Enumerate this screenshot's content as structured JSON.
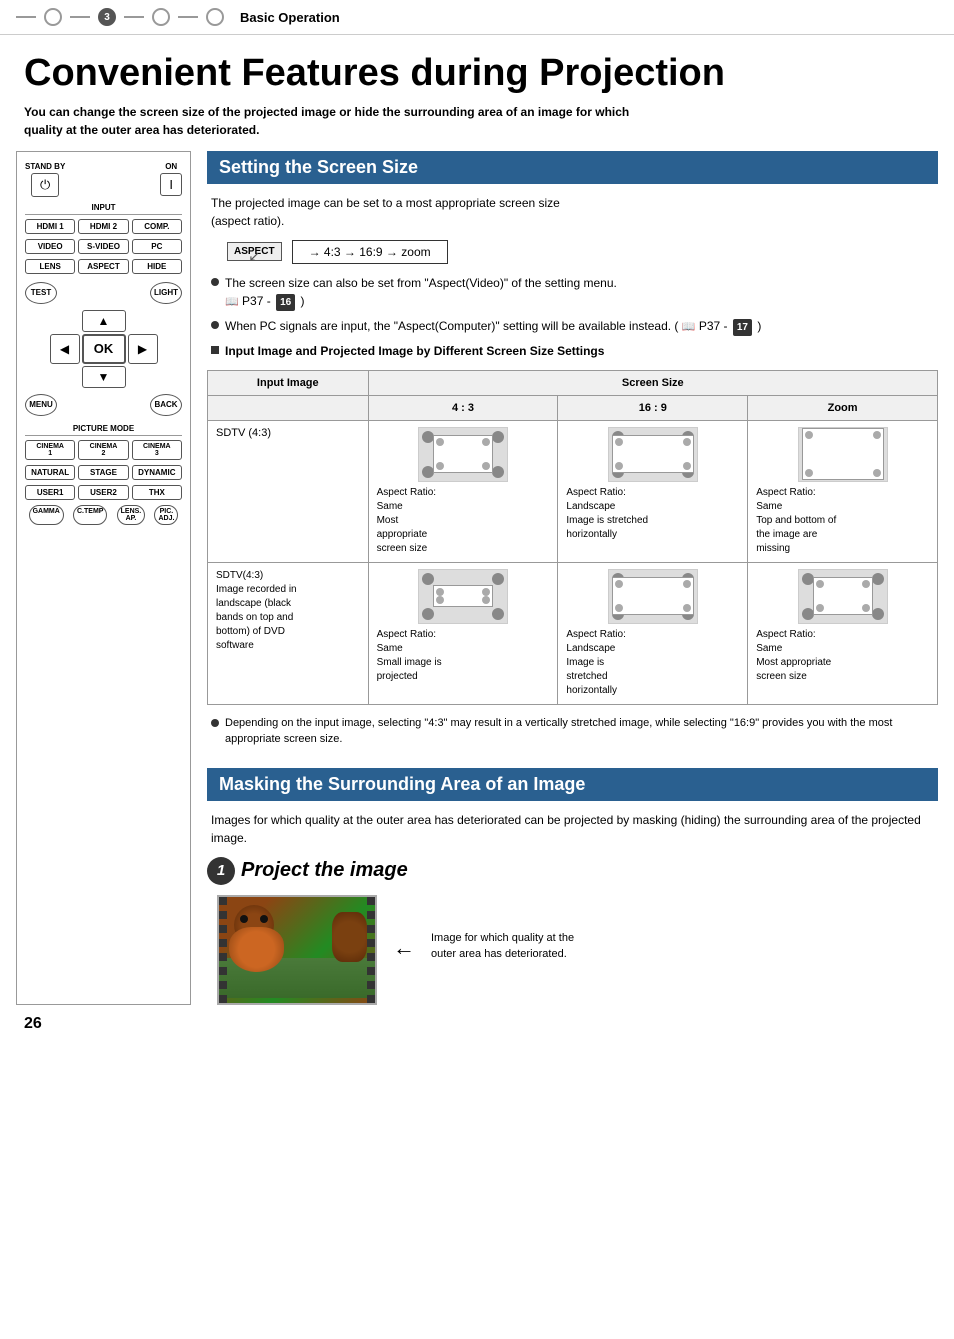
{
  "nav": {
    "step": "3",
    "title": "Basic Operation"
  },
  "page_title": "Convenient Features during Projection",
  "subtitle": "You can change the screen size of the projected image or hide the surrounding area of an image for which\nquality at the outer area has deteriorated.",
  "setting_screen_size": {
    "header": "Setting the Screen Size",
    "text": "The projected image can be set to a most appropriate screen size\n(aspect ratio).",
    "aspect_btn": "ASPECT",
    "aspect_sequence": "→ 4:3 → 16:9 → zoom",
    "bullet1": "The screen size can also be set from \"Aspect(Video)\" of the setting menu.",
    "bullet1_ref": "P37 -",
    "bullet1_badge": "16",
    "bullet2": "When PC signals are input, the \"Aspect(Computer)\" setting will be available instead.",
    "bullet2_ref": "P37 -",
    "bullet2_badge": "17",
    "table_header": "Input Image and Projected Image by Different Screen Size Settings",
    "table": {
      "screen_size_label": "Screen Size",
      "input_image_label": "Input Image",
      "cols": [
        "4 : 3",
        "16 : 9",
        "Zoom"
      ],
      "rows": [
        {
          "input_label": "SDTV (4:3)",
          "cells": [
            {
              "desc": "Aspect Ratio:\nSame\nMost\nappropriate\nscreen size",
              "img_type": "normal"
            },
            {
              "desc": "Aspect Ratio:\nLandscape\nImage is stretched\nhorizontally",
              "img_type": "wide"
            },
            {
              "desc": "Aspect Ratio:\nSame\nTop and bottom of\nthe image are\nmissing",
              "img_type": "crop_top_bottom"
            }
          ]
        },
        {
          "input_label": "SDTV(4:3)\nImage recorded in\nlandscape (black\nbands on top and\nbottom) of DVD\nsoftware",
          "cells": [
            {
              "desc": "Aspect Ratio:\nSame\nSmall image is\nprojected",
              "img_type": "small_in_normal"
            },
            {
              "desc": "Aspect Ratio:\nLandscape\nImage is\nstretched\nhorizontally",
              "img_type": "wide"
            },
            {
              "desc": "Aspect Ratio:\nSame\nMost appropriate\nscreen size",
              "img_type": "normal"
            }
          ]
        }
      ]
    },
    "note": "Depending on the input image, selecting \"4:3\" may result in a vertically stretched image, while selecting \"16:9\" provides you with the most appropriate screen size."
  },
  "masking": {
    "header": "Masking the Surrounding Area of an Image",
    "text": "Images for which quality at the outer area has deteriorated can be projected by masking (hiding) the surrounding area of the projected image.",
    "step1_number": "1",
    "step1_title": "Project the image",
    "image_caption": "Image for which quality at the outer area has deteriorated."
  },
  "remote": {
    "stand_by": "STAND BY",
    "on": "ON",
    "input": "INPUT",
    "hdmi1": "HDMI 1",
    "hdmi2": "HDMI 2",
    "comp": "COMP.",
    "video": "VIDEO",
    "svideo": "S-VIDEO",
    "pc": "PC",
    "lens": "LENS",
    "aspect": "ASPECT",
    "hide": "HIDE",
    "test": "TEST",
    "light": "LIGHT",
    "ok": "OK",
    "menu": "MENU",
    "back": "BACK",
    "picture_mode": "PICTURE MODE",
    "cinema1": "CINEMA\n1",
    "cinema2": "CINEMA\n2",
    "cinema3": "CINEMA\n3",
    "natural": "NATURAL",
    "stage": "STAGE",
    "dynamic": "DYNAMIC",
    "user1": "USER1",
    "user2": "USER2",
    "thx": "THX",
    "gamma": "GAMMA",
    "ctemp": "C.TEMP",
    "lens_ap": "LENS.\nAP.",
    "pic_adj": "PIC.\nADJ."
  },
  "page_number": "26"
}
